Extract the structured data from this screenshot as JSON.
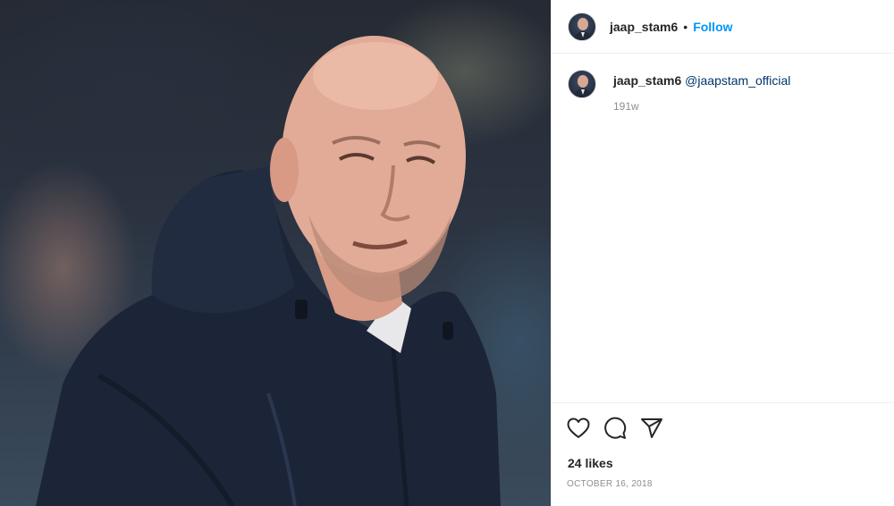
{
  "post": {
    "author": "jaap_stam6",
    "follow_label": "Follow",
    "separator": "•"
  },
  "caption": {
    "author": "jaap_stam6",
    "mention": "@jaapstam_official",
    "age": "191w"
  },
  "engagement": {
    "likes": "24 likes",
    "date": "October 16, 2018"
  },
  "icons": {
    "like": "heart-icon",
    "comment": "comment-icon",
    "share": "send-icon"
  },
  "colors": {
    "follow_blue": "#0095f6",
    "mention_blue": "#00376b",
    "muted_gray": "#8e8e8e",
    "text": "#262626",
    "jacket_navy": "#1c2537"
  }
}
